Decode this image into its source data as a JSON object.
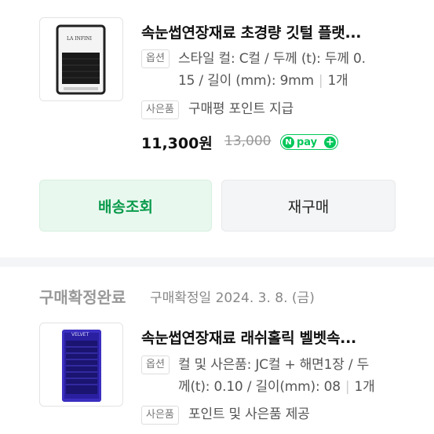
{
  "order1": {
    "title": "속눈썹연장재료 초경량 깃털 플랫...",
    "option_tag": "옵션",
    "option_line1": "스타일 컬: C컬 / 두께 (t): 두께 0.",
    "option_line2": "15 / 길이 (mm): 9mm",
    "quantity": "1개",
    "gift_tag": "사은품",
    "gift_text": "구매평 포인트 지급",
    "price": "11,300원",
    "original_price": "13,000",
    "pay_badge": "pay",
    "pay_n": "N",
    "pay_plus": "+",
    "thumb_brand": "LA INFINI"
  },
  "buttons": {
    "shipping": "배송조회",
    "rebuy": "재구매"
  },
  "order2": {
    "status": "구매확정완료",
    "status_date": "구매확정일 2024. 3. 8. (금)",
    "title": "속눈썹연장재료 래쉬홀릭 벨벳속...",
    "option_tag": "옵션",
    "option_line1": "컬 및 사은품: JC컬 + 해면1장 / 두",
    "option_line2": "께(t): 0.10 / 길이(mm): 08",
    "quantity": "1개",
    "gift_tag": "사은품",
    "gift_text": "포인트 및 사은품 제공",
    "thumb_brand": "VELVET"
  },
  "colors": {
    "accent_green": "#03c75a",
    "ship_button_text": "#0a9b4c"
  }
}
